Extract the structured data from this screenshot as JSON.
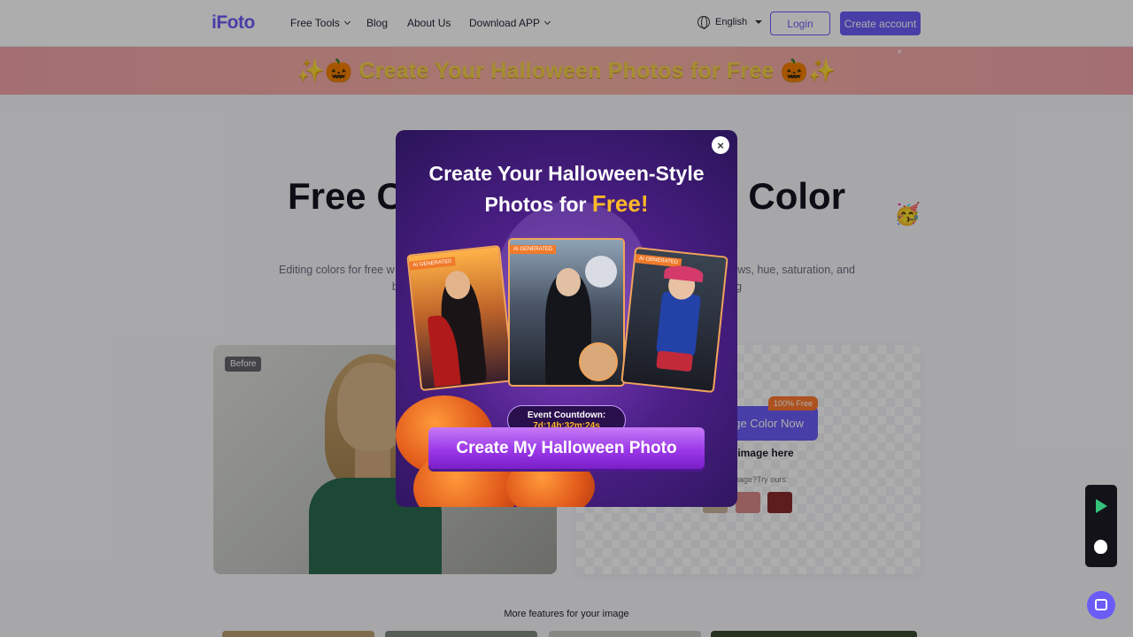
{
  "nav": {
    "logo": "iFoto",
    "links": [
      {
        "label": "Free Tools",
        "has_dropdown": true
      },
      {
        "label": "Blog",
        "has_dropdown": false
      },
      {
        "label": "About Us",
        "has_dropdown": false
      },
      {
        "label": "Download APP",
        "has_dropdown": true
      }
    ],
    "language": "English",
    "login": "Login",
    "create_account": "Create account"
  },
  "banner": {
    "text": "✨🎃 Create Your Halloween Photos for Free 🎃✨",
    "close": "×"
  },
  "hero": {
    "title": "Free Colo                         e Color",
    "emoji": "🥳",
    "description": "Editing colors for free w                                                                               and, contrast, shadows, hue, saturation, and brig                                                                  ns all in one place to bring"
  },
  "before_card": {
    "tag": "Before"
  },
  "upload_card": {
    "free_badge": "100% Free",
    "button": "ge Color Now",
    "drop_text": "an image here",
    "try_text": "n image?Try ours:"
  },
  "more_features": "More features for your image",
  "modal": {
    "close": "×",
    "title_line1": "Create Your Halloween-Style",
    "title_line2": "Photos for ",
    "title_free": "Free!",
    "card_tags": [
      "AI GENERATED",
      "AI GENERATED",
      "AI GENERATED"
    ],
    "countdown_label": "Event Countdown:",
    "countdown_time": "7d:14h:32m:24s",
    "cta": "Create My Halloween Photo"
  },
  "colors": {
    "brand": "#6b5cf6",
    "banner_bg": "#f2a3a8",
    "modal_bg": "#4b1f86",
    "cta": "#9b38e8",
    "accent_orange": "#ffb829"
  },
  "icons": [
    "globe-icon",
    "chevron-down-icon",
    "close-icon",
    "google-play-icon",
    "apple-icon",
    "chat-icon"
  ]
}
